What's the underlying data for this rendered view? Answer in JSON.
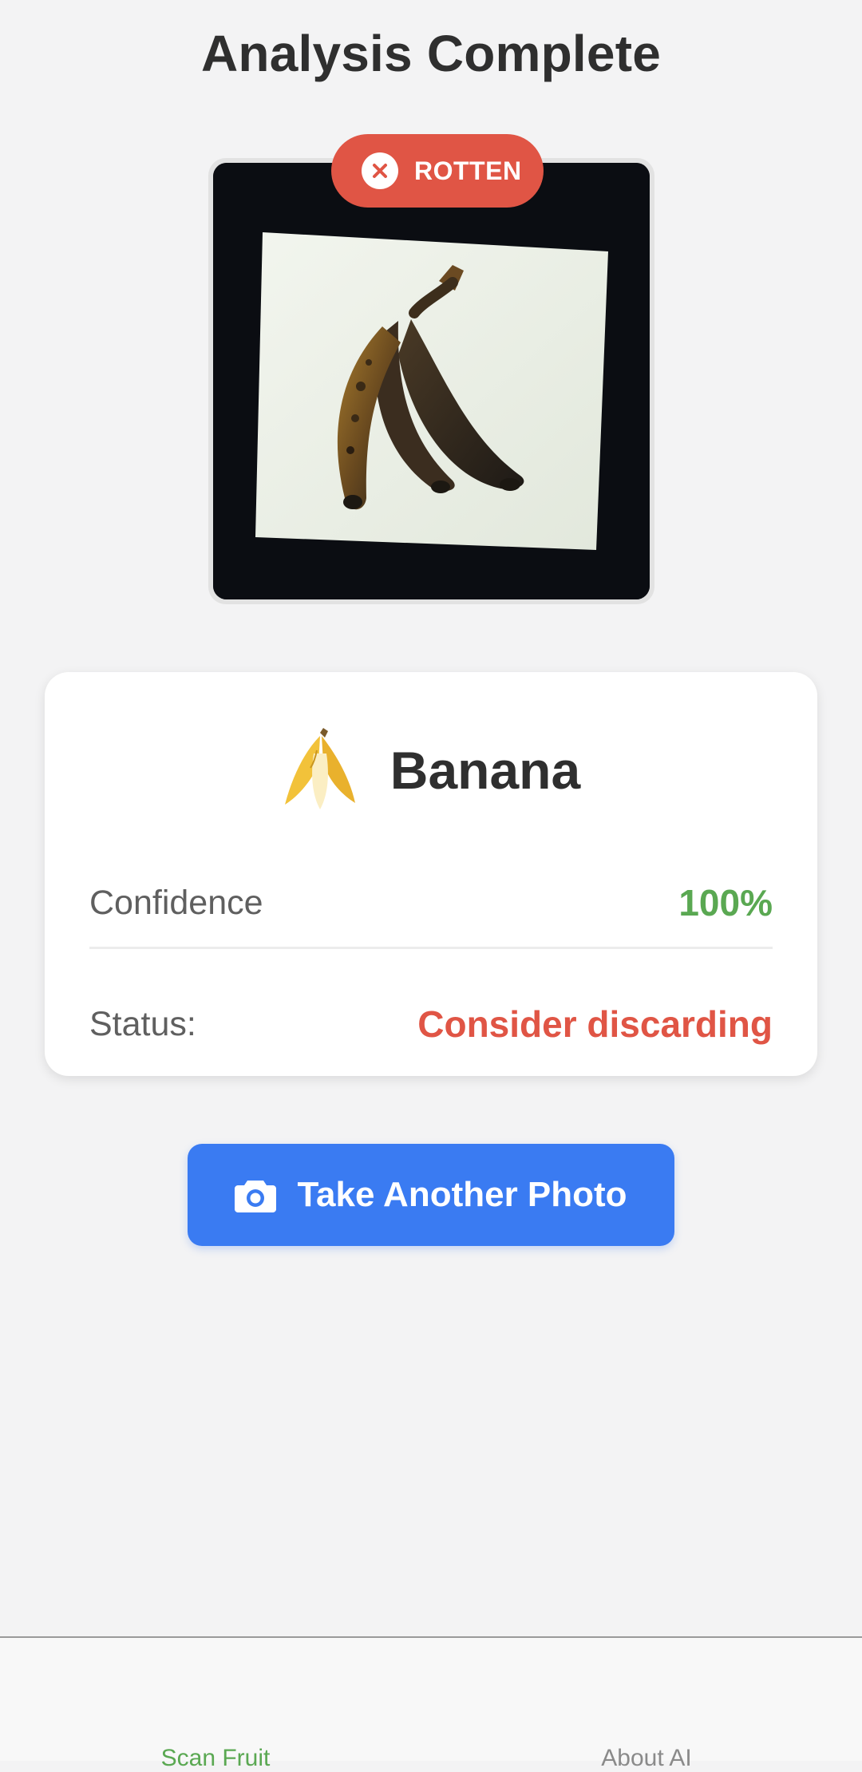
{
  "header": {
    "title": "Analysis Complete"
  },
  "result": {
    "verdict": "ROTTEN",
    "fruit_emoji": "banana",
    "fruit_name": "Banana",
    "confidence_label": "Confidence",
    "confidence_value": "100%",
    "status_label": "Status:",
    "status_value": "Consider discarding"
  },
  "actions": {
    "retake_label": "Take Another Photo"
  },
  "tabs": [
    {
      "label": "Scan Fruit",
      "active": true
    },
    {
      "label": "About AI",
      "active": false
    }
  ],
  "colors": {
    "background": "#f3f3f4",
    "rotten_red": "#e05545",
    "confidence_green": "#5aa852",
    "primary_blue": "#3a7bf2",
    "active_tab_green": "#5aa852",
    "inactive_tab_gray": "#8a8a8a"
  },
  "icons": {
    "badge": "close-circle-icon",
    "button": "camera-icon"
  }
}
